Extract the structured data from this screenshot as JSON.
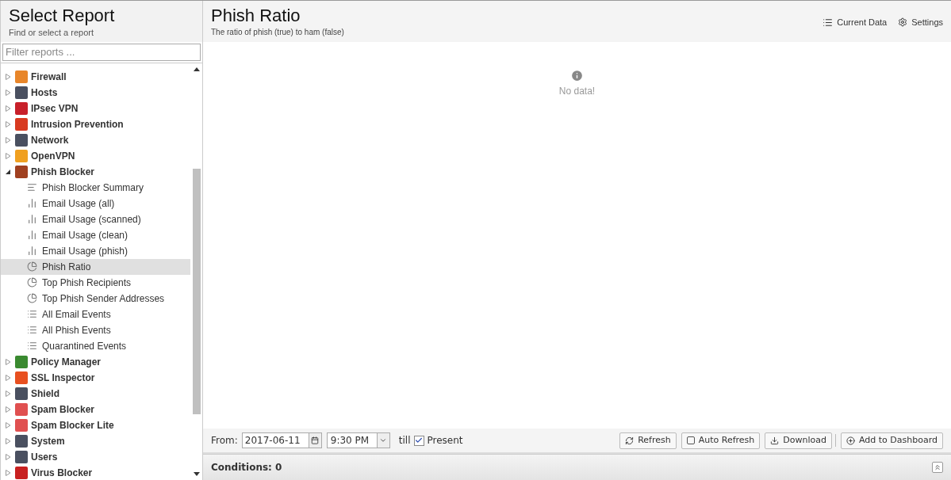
{
  "sidebar": {
    "title": "Select Report",
    "subtitle": "Find or select a report",
    "filter": {
      "placeholder": "Filter reports ..."
    },
    "tree": [
      {
        "label": "Firewall",
        "color": "#e8862a",
        "expanded": false,
        "selected": false
      },
      {
        "label": "Hosts",
        "color": "#4a5060",
        "expanded": false,
        "selected": false
      },
      {
        "label": "IPsec VPN",
        "color": "#c8202a",
        "expanded": false,
        "selected": false
      },
      {
        "label": "Intrusion Prevention",
        "color": "#d83a20",
        "expanded": false,
        "selected": false
      },
      {
        "label": "Network",
        "color": "#4a5060",
        "expanded": false,
        "selected": false
      },
      {
        "label": "OpenVPN",
        "color": "#f0a020",
        "expanded": false,
        "selected": false
      },
      {
        "label": "Phish Blocker",
        "color": "#a04020",
        "expanded": true,
        "selected": false,
        "children": [
          {
            "label": "Phish Blocker Summary",
            "kind": "summary",
            "selected": false
          },
          {
            "label": "Email Usage (all)",
            "kind": "bar",
            "selected": false
          },
          {
            "label": "Email Usage (scanned)",
            "kind": "bar",
            "selected": false
          },
          {
            "label": "Email Usage (clean)",
            "kind": "bar",
            "selected": false
          },
          {
            "label": "Email Usage (phish)",
            "kind": "bar",
            "selected": false
          },
          {
            "label": "Phish Ratio",
            "kind": "pie",
            "selected": true
          },
          {
            "label": "Top Phish Recipients",
            "kind": "pie",
            "selected": false
          },
          {
            "label": "Top Phish Sender Addresses",
            "kind": "pie",
            "selected": false
          },
          {
            "label": "All Email Events",
            "kind": "list",
            "selected": false
          },
          {
            "label": "All Phish Events",
            "kind": "list",
            "selected": false
          },
          {
            "label": "Quarantined Events",
            "kind": "list",
            "selected": false
          }
        ]
      },
      {
        "label": "Policy Manager",
        "color": "#3a8a30",
        "expanded": false,
        "selected": false
      },
      {
        "label": "SSL Inspector",
        "color": "#e85020",
        "expanded": false,
        "selected": false
      },
      {
        "label": "Shield",
        "color": "#4a5060",
        "expanded": false,
        "selected": false
      },
      {
        "label": "Spam Blocker",
        "color": "#e05050",
        "expanded": false,
        "selected": false
      },
      {
        "label": "Spam Blocker Lite",
        "color": "#e05050",
        "expanded": false,
        "selected": false
      },
      {
        "label": "System",
        "color": "#4a5060",
        "expanded": false,
        "selected": false
      },
      {
        "label": "Users",
        "color": "#4a5060",
        "expanded": false,
        "selected": false
      },
      {
        "label": "Virus Blocker",
        "color": "#c82020",
        "expanded": false,
        "selected": false
      }
    ]
  },
  "report": {
    "title": "Phish Ratio",
    "description": "The ratio of phish (true) to ham (false)",
    "actions": [
      "Current Data",
      "Settings"
    ],
    "message": "No data!"
  },
  "toolbar": {
    "from_label": "From:",
    "date": "2017-06-11",
    "time": "9:30 PM",
    "till_label": "till",
    "present": {
      "label": "Present",
      "checked": true
    },
    "buttons": [
      {
        "label": "Refresh",
        "kind": "refresh"
      },
      {
        "label": "Auto Refresh",
        "kind": "checkbox",
        "checked": false
      },
      {
        "label": "Download",
        "kind": "download"
      },
      {
        "label": "Add to Dashboard",
        "kind": "add"
      }
    ]
  },
  "conditions": "Conditions: 0"
}
